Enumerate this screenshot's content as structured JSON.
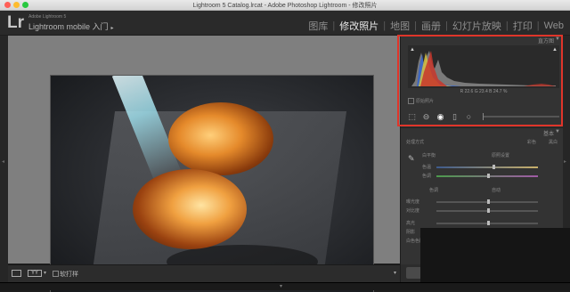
{
  "window": {
    "title": "Lightroom 5 Catalog.lrcat - Adobe Photoshop Lightroom - 修改照片"
  },
  "header": {
    "logo": "Lr",
    "product_small": "Adobe Lightroom 5",
    "identity_label": "Lightroom mobile 入门",
    "identity_arrow": "▸"
  },
  "modules": [
    {
      "label": "图库",
      "active": false
    },
    {
      "label": "修改照片",
      "active": true
    },
    {
      "label": "地图",
      "active": false
    },
    {
      "label": "画册",
      "active": false
    },
    {
      "label": "幻灯片放映",
      "active": false
    },
    {
      "label": "打印",
      "active": false
    },
    {
      "label": "Web",
      "active": false
    }
  ],
  "histogram_panel": {
    "label": "直方图",
    "collapse_icon": "▼",
    "clip_left": "▲",
    "clip_right": "▲",
    "info": "R 22.6  G 23.4  B 24.7 %",
    "original_photo_label": "原始照片"
  },
  "tools": [
    "crop-overlay-icon",
    "spot-removal-icon",
    "red-eye-icon",
    "graduated-filter-icon",
    "radial-filter-icon",
    "adjustment-brush-icon"
  ],
  "basic_panel": {
    "label": "基本",
    "collapse_icon": "▼",
    "treatment_label": "处理方式",
    "color_label": "彩色",
    "bw_label": "黑白",
    "wb_label": "白平衡",
    "wb_value": "原照设置",
    "temp_label": "色温",
    "tint_label": "色调",
    "tone_label": "色调",
    "auto_label": "自动",
    "exposure_label": "曝光度",
    "contrast_label": "对比度",
    "highlights_label": "高光",
    "shadows_label": "阴影",
    "whites_label": "白色色阶"
  },
  "bottom_toolbar": {
    "yy_label": "YY",
    "softproof_label": "软打样",
    "menu_arrow": "▾"
  },
  "accent": {
    "highlight_border": "#e0352a",
    "active_module": "#e8e8e8",
    "inactive_module": "#8f8f8f"
  }
}
